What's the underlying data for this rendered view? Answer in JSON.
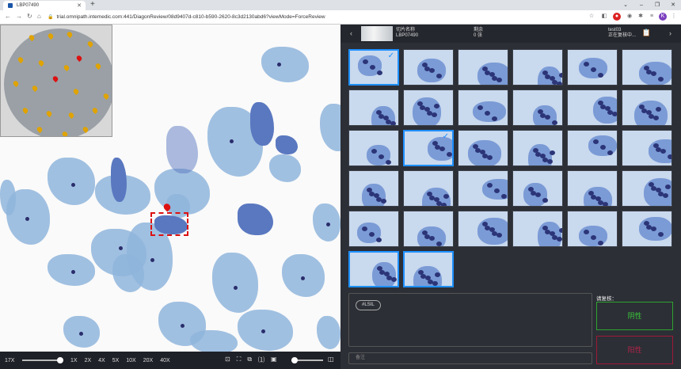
{
  "browser": {
    "tab_title": "LBP07490",
    "url": "trial.omnipath.intemedic.com:441/DiagonReview/08d9407d-c810-b590-2620-8c3d2130abd6?viewMode=ForceReview",
    "profile_initial": "K"
  },
  "viewer": {
    "zoom_value": "17X",
    "zoom_options": [
      "1X",
      "2X",
      "4X",
      "5X",
      "10X",
      "20X",
      "40X"
    ]
  },
  "header": {
    "slide_name_label": "切片名称",
    "slide_name_value": "LBP07490",
    "remaining_label": "剩余",
    "remaining_value": "0 张",
    "user_name": "test03",
    "user_status": "正在复核中..."
  },
  "annotation": {
    "tag": "#LSIL",
    "remark_placeholder": "备注"
  },
  "review": {
    "title": "请复核：",
    "negative_label": "阴性",
    "positive_label": "阳性"
  },
  "colors": {
    "accent": "#1e90ff",
    "negative": "#3bc43b",
    "positive": "#b0244a"
  }
}
